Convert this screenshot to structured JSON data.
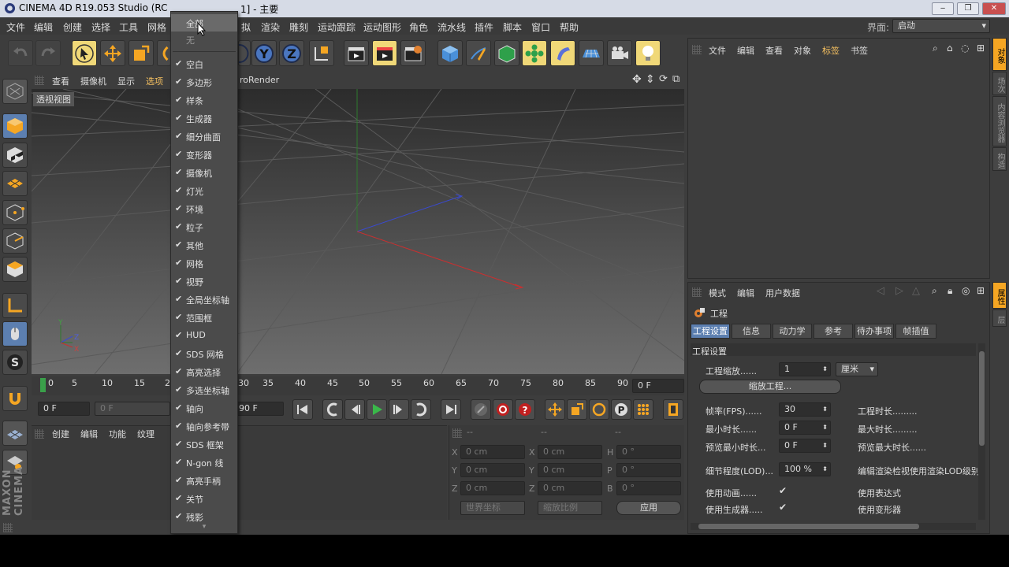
{
  "window": {
    "title": "CINEMA 4D R19.053 Studio (RC",
    "title_tail": "1] - 主要",
    "min": "‒",
    "max": "❐",
    "close": "✕"
  },
  "menubar": [
    "文件",
    "编辑",
    "创建",
    "选择",
    "工具",
    "网格",
    "拟",
    "渲染",
    "雕刻",
    "运动跟踪",
    "运动图形",
    "角色",
    "流水线",
    "插件",
    "脚本",
    "窗口",
    "帮助"
  ],
  "layout": {
    "label": "界面:",
    "value": "启动"
  },
  "viewport": {
    "menu": [
      "查看",
      "摄像机",
      "显示",
      "选项"
    ],
    "renderer": "roRender",
    "label": "透视视图"
  },
  "popup": {
    "top": [
      "全部",
      "无"
    ],
    "items": [
      "空白",
      "多边形",
      "样条",
      "生成器",
      "细分曲面",
      "变形器",
      "摄像机",
      "灯光",
      "环境",
      "粒子",
      "其他",
      "网格",
      "视野",
      "全局坐标轴",
      "范围框",
      "HUD",
      "SDS 网格",
      "高亮选择",
      "多选坐标轴",
      "轴向",
      "轴向参考带",
      "SDS 框架",
      "N-gon 线",
      "高亮手柄",
      "关节",
      "残影"
    ],
    "check": "✔",
    "more": "▾"
  },
  "timeline": {
    "ticks": [
      "0",
      "5",
      "10",
      "15",
      "2",
      "30",
      "35",
      "40",
      "45",
      "50",
      "55",
      "60",
      "65",
      "70",
      "75",
      "80",
      "85",
      "90"
    ],
    "end_frame": "0 F"
  },
  "playback": {
    "start": "0 F",
    "cur": "0 F",
    "end": "90 F"
  },
  "materials": {
    "menu": [
      "创建",
      "编辑",
      "功能",
      "纹理"
    ]
  },
  "coords": {
    "header": [
      "--",
      "--",
      "--"
    ],
    "rows": [
      {
        "a": "X",
        "av": "0 cm",
        "b": "X",
        "bv": "0 cm",
        "c": "H",
        "cv": "0 °"
      },
      {
        "a": "Y",
        "av": "0 cm",
        "b": "Y",
        "bv": "0 cm",
        "c": "P",
        "cv": "0 °"
      },
      {
        "a": "Z",
        "av": "0 cm",
        "b": "Z",
        "bv": "0 cm",
        "c": "B",
        "cv": "0 °"
      }
    ],
    "world": "世界坐标",
    "scale": "缩放比例",
    "apply": "应用"
  },
  "objects": {
    "menu": [
      "文件",
      "编辑",
      "查看",
      "对象",
      "标签",
      "书签"
    ]
  },
  "side_tabs": [
    "对象",
    "场次",
    "内容浏览器",
    "构造"
  ],
  "side_tabs2": [
    "属性",
    "层"
  ],
  "attributes": {
    "menu": [
      "模式",
      "编辑",
      "用户数据"
    ],
    "title": "工程",
    "tabs": [
      "工程设置",
      "信息",
      "动力学",
      "参考",
      "待办事项",
      "帧插值"
    ],
    "section": "工程设置",
    "scale_label": "工程缩放......",
    "scale_value": "1",
    "unit": "厘米",
    "scale_btn": "缩放工程...",
    "left_rows": [
      {
        "label": "帧率(FPS)......",
        "value": "30"
      },
      {
        "label": "最小时长......",
        "value": "0 F"
      },
      {
        "label": "预览最小时长...",
        "value": "0 F"
      }
    ],
    "right_rows": [
      "工程时长.........",
      "最大时长.........",
      "预览最大时长......"
    ],
    "lod_label": "细节程度(LOD)...",
    "lod_value": "100 %",
    "lod_right": "编辑渲染检视使用渲染LOD级别",
    "use_anim": "使用动画......",
    "use_gen": "使用生成器.....",
    "use_expr": "使用表达式",
    "use_deform": "使用变形器",
    "check": "✔"
  },
  "colors": {
    "accent": "#5c7fb0",
    "highlight": "#f0d878",
    "axis_x": "#d03030",
    "axis_y": "#30a030",
    "axis_z": "#3050d0"
  }
}
